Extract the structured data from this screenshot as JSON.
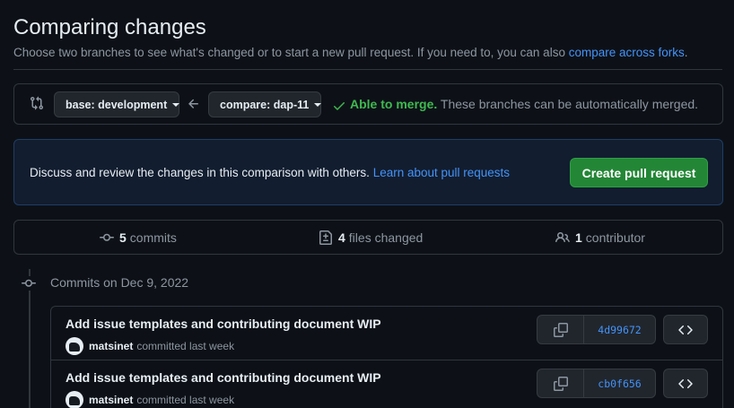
{
  "header": {
    "title": "Comparing changes",
    "subtitle_prefix": "Choose two branches to see what's changed or to start a new pull request. If you need to, you can also",
    "subtitle_link": "compare across forks",
    "subtitle_suffix": "."
  },
  "compare_bar": {
    "base_label": "base: development",
    "compare_label": "compare: dap-11",
    "merge_status": "Able to merge.",
    "merge_note": "These branches can be automatically merged.",
    "merge_color": "#3fb950"
  },
  "info_banner": {
    "text": "Discuss and review the changes in this comparison with others.",
    "link": "Learn about pull requests",
    "button_label": "Create pull request",
    "button_color": "#238636"
  },
  "stats": {
    "commits_count": "5",
    "commits_label": "commits",
    "files_count": "4",
    "files_label": "files changed",
    "contributors_count": "1",
    "contributors_label": "contributor"
  },
  "timeline": {
    "date_label": "Commits on Dec 9, 2022"
  },
  "commits": [
    {
      "title": "Add issue templates and contributing document WIP",
      "author": "matsinet",
      "meta": "committed last week",
      "sha": "4d99672"
    },
    {
      "title": "Add issue templates and contributing document WIP",
      "author": "matsinet",
      "meta": "committed last week",
      "sha": "cb0f656"
    }
  ]
}
